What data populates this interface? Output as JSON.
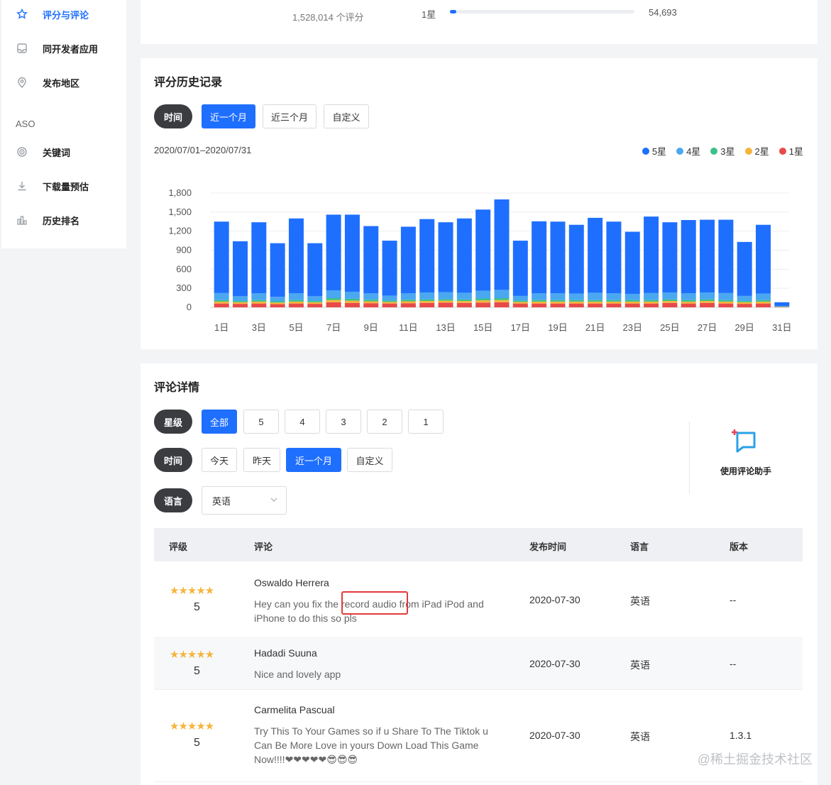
{
  "sidebar": {
    "items": [
      {
        "label": "评分与评论",
        "icon": "star-icon",
        "active": true
      },
      {
        "label": "同开发者应用",
        "icon": "inbox-icon"
      },
      {
        "label": "发布地区",
        "icon": "location-pin-icon"
      }
    ],
    "section_label": "ASO",
    "aso_items": [
      {
        "label": "关键词",
        "icon": "target-icon"
      },
      {
        "label": "下载量预估",
        "icon": "download-icon"
      },
      {
        "label": "历史排名",
        "icon": "bar-chart-icon"
      }
    ]
  },
  "ratings_summary": {
    "total_text": "1,528,014 个评分",
    "star_label": "1星",
    "star_fraction": 0.035,
    "star_count": "54,693"
  },
  "history": {
    "title": "评分历史记录",
    "filter_pill": "时间",
    "range_buttons": [
      "近一个月",
      "近三个月",
      "自定义"
    ],
    "active_range": "近一个月",
    "date_range": "2020/07/01–2020/07/31",
    "legend": [
      {
        "label": "5星",
        "color": "#1f6fff"
      },
      {
        "label": "4星",
        "color": "#4aa8f0"
      },
      {
        "label": "3星",
        "color": "#3cc08a"
      },
      {
        "label": "2星",
        "color": "#f5b53b"
      },
      {
        "label": "1星",
        "color": "#e84a4a"
      }
    ]
  },
  "chart_data": {
    "type": "bar",
    "stacked": true,
    "ylim": [
      0,
      1800
    ],
    "yticks": [
      "0",
      "300",
      "600",
      "900",
      "1,200",
      "1,500",
      "1,800"
    ],
    "ytick_values": [
      0,
      300,
      600,
      900,
      1200,
      1500,
      1800
    ],
    "categories": [
      "1日",
      "2日",
      "3日",
      "4日",
      "5日",
      "6日",
      "7日",
      "8日",
      "9日",
      "10日",
      "11日",
      "12日",
      "13日",
      "14日",
      "15日",
      "16日",
      "17日",
      "18日",
      "19日",
      "20日",
      "21日",
      "22日",
      "23日",
      "24日",
      "25日",
      "26日",
      "27日",
      "28日",
      "29日",
      "30日",
      "31日"
    ],
    "xtick_labels": [
      "1日",
      "3日",
      "5日",
      "7日",
      "9日",
      "11日",
      "13日",
      "15日",
      "17日",
      "19日",
      "21日",
      "23日",
      "25日",
      "27日",
      "29日",
      "31日"
    ],
    "series": [
      {
        "name": "1星",
        "color": "#e84a4a",
        "values": [
          60,
          55,
          60,
          50,
          60,
          55,
          80,
          70,
          65,
          60,
          65,
          70,
          75,
          70,
          75,
          80,
          60,
          60,
          60,
          60,
          60,
          60,
          60,
          60,
          70,
          60,
          70,
          60,
          55,
          60,
          5
        ]
      },
      {
        "name": "2星",
        "color": "#f5b53b",
        "values": [
          30,
          25,
          30,
          25,
          30,
          25,
          35,
          35,
          30,
          25,
          30,
          30,
          30,
          30,
          35,
          35,
          25,
          30,
          30,
          30,
          30,
          30,
          30,
          30,
          30,
          30,
          30,
          30,
          25,
          30,
          3
        ]
      },
      {
        "name": "3星",
        "color": "#3cc08a",
        "values": [
          25,
          20,
          25,
          20,
          25,
          20,
          30,
          30,
          25,
          20,
          25,
          25,
          25,
          25,
          30,
          30,
          20,
          25,
          25,
          25,
          25,
          25,
          25,
          25,
          25,
          25,
          25,
          25,
          20,
          25,
          3
        ]
      },
      {
        "name": "4星",
        "color": "#4aa8f0",
        "values": [
          110,
          75,
          105,
          70,
          105,
          75,
          120,
          110,
          100,
          80,
          100,
          110,
          110,
          105,
          120,
          130,
          75,
          105,
          105,
          100,
          115,
          105,
          95,
          110,
          110,
          105,
          110,
          110,
          80,
          100,
          9
        ]
      },
      {
        "name": "5星",
        "color": "#1f6fff",
        "values": [
          1125,
          865,
          1120,
          845,
          1180,
          835,
          1195,
          1215,
          1060,
          865,
          1050,
          1155,
          1100,
          1170,
          1280,
          1425,
          870,
          1135,
          1130,
          1085,
          1180,
          1130,
          980,
          1205,
          1105,
          1155,
          1145,
          1155,
          850,
          1085,
          60
        ]
      }
    ]
  },
  "reviews": {
    "title": "评论详情",
    "filters": {
      "star_pill": "星级",
      "star_buttons": [
        "全部",
        "5",
        "4",
        "3",
        "2",
        "1"
      ],
      "active_star": "全部",
      "time_pill": "时间",
      "time_buttons": [
        "今天",
        "昨天",
        "近一个月",
        "自定义"
      ],
      "active_time": "近一个月",
      "lang_pill": "语言",
      "lang_value": "英语"
    },
    "assistant_label": "使用评论助手",
    "columns": [
      "评级",
      "评论",
      "发布时间",
      "语言",
      "版本"
    ],
    "rows": [
      {
        "stars": "★★★★★",
        "score": "5",
        "author": "Oswaldo Herrera",
        "text": "Hey can you fix the record audio from iPad iPod and iPhone to do this so pls",
        "date": "2020-07-30",
        "lang": "英语",
        "version": "--"
      },
      {
        "stars": "★★★★★",
        "score": "5",
        "author": "Hadadi Suuna",
        "text": "Nice and lovely app",
        "date": "2020-07-30",
        "lang": "英语",
        "version": "--"
      },
      {
        "stars": "★★★★★",
        "score": "5",
        "author": "Carmelita Pascual",
        "text": "Try This To Your Games so if u Share To The Tiktok u Can Be More Love in yours Down Load This Game Now!!!!❤❤❤❤❤😎😎😎",
        "date": "2020-07-30",
        "lang": "英语",
        "version": "1.3.1"
      }
    ]
  },
  "watermark": "@稀土掘金技术社区"
}
